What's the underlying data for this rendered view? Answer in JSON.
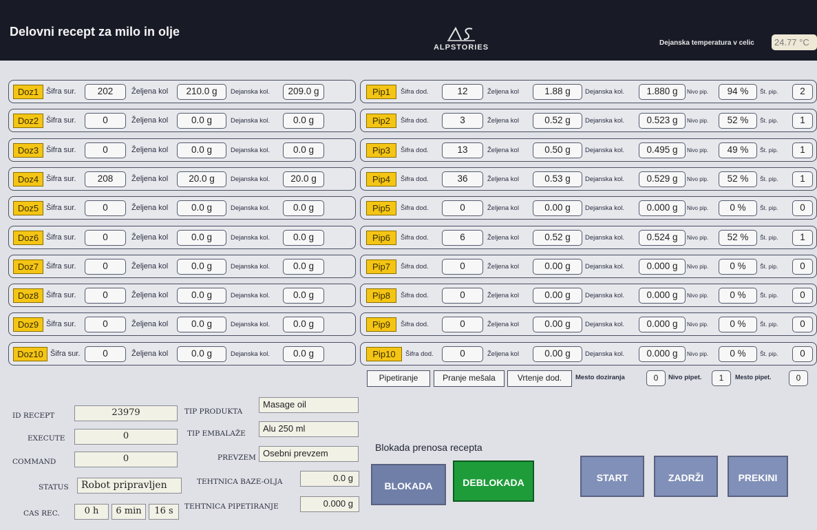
{
  "header": {
    "title": "Delovni recept za milo in olje",
    "logo_text": "ALPSTORIES",
    "temp_label": "Dejanska temperatura v celic",
    "temp_value": "24.77 °C"
  },
  "labels": {
    "sifra_sur": "Šifra sur.",
    "sifra_dod": "Šifra dod.",
    "zeljena": "Željena kol",
    "dejanska": "Dejanska kol.",
    "nivo": "Nivo pip.",
    "st_pip": "Št. pip."
  },
  "doz_rows": [
    {
      "tag": "Doz1",
      "sifra": "202",
      "zeljena": "210.0 g",
      "dejanska": "209.0 g"
    },
    {
      "tag": "Doz2",
      "sifra": "0",
      "zeljena": "0.0 g",
      "dejanska": "0.0 g"
    },
    {
      "tag": "Doz3",
      "sifra": "0",
      "zeljena": "0.0 g",
      "dejanska": "0.0 g"
    },
    {
      "tag": "Doz4",
      "sifra": "208",
      "zeljena": "20.0 g",
      "dejanska": "20.0 g"
    },
    {
      "tag": "Doz5",
      "sifra": "0",
      "zeljena": "0.0 g",
      "dejanska": "0.0 g"
    },
    {
      "tag": "Doz6",
      "sifra": "0",
      "zeljena": "0.0 g",
      "dejanska": "0.0 g"
    },
    {
      "tag": "Doz7",
      "sifra": "0",
      "zeljena": "0.0 g",
      "dejanska": "0.0 g"
    },
    {
      "tag": "Doz8",
      "sifra": "0",
      "zeljena": "0.0 g",
      "dejanska": "0.0 g"
    },
    {
      "tag": "Doz9",
      "sifra": "0",
      "zeljena": "0.0 g",
      "dejanska": "0.0 g"
    },
    {
      "tag": "Doz10",
      "sifra": "0",
      "zeljena": "0.0 g",
      "dejanska": "0.0 g"
    }
  ],
  "pip_rows": [
    {
      "tag": "Pip1",
      "sifra": "12",
      "zeljena": "1.88 g",
      "dejanska": "1.880 g",
      "nivo": "94 %",
      "st": "2"
    },
    {
      "tag": "Pip2",
      "sifra": "3",
      "zeljena": "0.52 g",
      "dejanska": "0.523 g",
      "nivo": "52 %",
      "st": "1"
    },
    {
      "tag": "Pip3",
      "sifra": "13",
      "zeljena": "0.50 g",
      "dejanska": "0.495 g",
      "nivo": "49 %",
      "st": "1"
    },
    {
      "tag": "Pip4",
      "sifra": "36",
      "zeljena": "0.53 g",
      "dejanska": "0.529 g",
      "nivo": "52 %",
      "st": "1"
    },
    {
      "tag": "Pip5",
      "sifra": "0",
      "zeljena": "0.00 g",
      "dejanska": "0.000 g",
      "nivo": "0 %",
      "st": "0"
    },
    {
      "tag": "Pip6",
      "sifra": "6",
      "zeljena": "0.52 g",
      "dejanska": "0.524 g",
      "nivo": "52 %",
      "st": "1"
    },
    {
      "tag": "Pip7",
      "sifra": "0",
      "zeljena": "0.00 g",
      "dejanska": "0.000 g",
      "nivo": "0 %",
      "st": "0"
    },
    {
      "tag": "Pip8",
      "sifra": "0",
      "zeljena": "0.00 g",
      "dejanska": "0.000 g",
      "nivo": "0 %",
      "st": "0"
    },
    {
      "tag": "Pip9",
      "sifra": "0",
      "zeljena": "0.00 g",
      "dejanska": "0.000 g",
      "nivo": "0 %",
      "st": "0"
    },
    {
      "tag": "Pip10",
      "sifra": "0",
      "zeljena": "0.00 g",
      "dejanska": "0.000 g",
      "nivo": "0 %",
      "st": "0"
    }
  ],
  "status_bar": {
    "pipetiranje": "Pipetiranje",
    "pranje": "Pranje mešala",
    "vrtenje": "Vrtenje dod.",
    "mesto_doz_label": "Mesto doziranja",
    "mesto_doz_value": "0",
    "nivo_pipet_label": "Nivo pipet.",
    "nivo_pipet_value": "1",
    "mesto_pipet_label": "Mesto pipet.",
    "mesto_pipet_value": "0"
  },
  "info": {
    "id_recept_label": "ID RECEPT",
    "id_recept": "23979",
    "execute_label": "EXECUTE",
    "execute": "0",
    "command_label": "COMMAND",
    "command": "0",
    "status_label": "STATUS",
    "status": "Robot pripravljen",
    "cas_label": "CAS REC.",
    "cas_h": "0 h",
    "cas_min": "6 min",
    "cas_s": "16 s",
    "tip_produkta_label": "TIP PRODUKTA",
    "tip_produkta": "Masage oil",
    "tip_embalaze_label": "TIP EMBALAŽE",
    "tip_embalaze": "Alu 250 ml",
    "prevzem_label": "PREVZEM",
    "prevzem": "Osebni prevzem",
    "tehtnica_baze_label": "TEHTNICA BAZE-OLJA",
    "tehtnica_baze": "0.0 g",
    "tehtnica_pip_label": "TEHTNICA PIPETIRANJE",
    "tehtnica_pip": "0.000 g"
  },
  "controls": {
    "blokada_title": "Blokada prenosa recepta",
    "blokada": "BLOKADA",
    "deblokada": "DEBLOKADA",
    "start": "START",
    "zadrzi": "ZADRŽI",
    "prekini": "PREKINI"
  },
  "colors": {
    "tag_yellow": "#f4c514",
    "deblokada_green": "#1f9c3a",
    "button_blue": "#6f7fa8",
    "header_dark": "#181a26"
  }
}
